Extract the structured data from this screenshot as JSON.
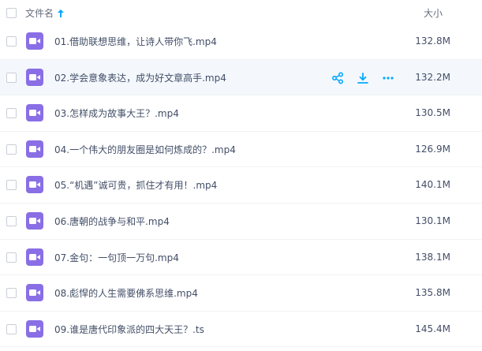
{
  "header": {
    "name_label": "文件名",
    "size_label": "大小"
  },
  "files": [
    {
      "name": "01.借助联想思维，让诗人带你飞.mp4",
      "size": "132.8M"
    },
    {
      "name": "02.学会意象表达，成为好文章高手.mp4",
      "size": "132.2M"
    },
    {
      "name": "03.怎样成为故事大王？.mp4",
      "size": "130.5M"
    },
    {
      "name": "04.一个伟大的朋友圈是如何炼成的？.mp4",
      "size": "126.9M"
    },
    {
      "name": "05.“机遇”诚可贵，抓住才有用！.mp4",
      "size": "140.1M"
    },
    {
      "name": "06.唐朝的战争与和平.mp4",
      "size": "130.1M"
    },
    {
      "name": "07.金句：一句顶一万句.mp4",
      "size": "138.1M"
    },
    {
      "name": "08.彪悍的人生需要佛系思维.mp4",
      "size": "135.8M"
    },
    {
      "name": "09.谁是唐代印象派的四大天王？.ts",
      "size": "145.4M"
    }
  ],
  "icons": {
    "file_type": "video-file-icon",
    "share": "share-icon",
    "download": "download-icon",
    "more": "more-icon",
    "sort": "sort-up-arrow-icon"
  },
  "colors": {
    "accent": "#06a7ff",
    "file_icon": "#8a6ee6",
    "hover_row": "#f4f8fd"
  }
}
